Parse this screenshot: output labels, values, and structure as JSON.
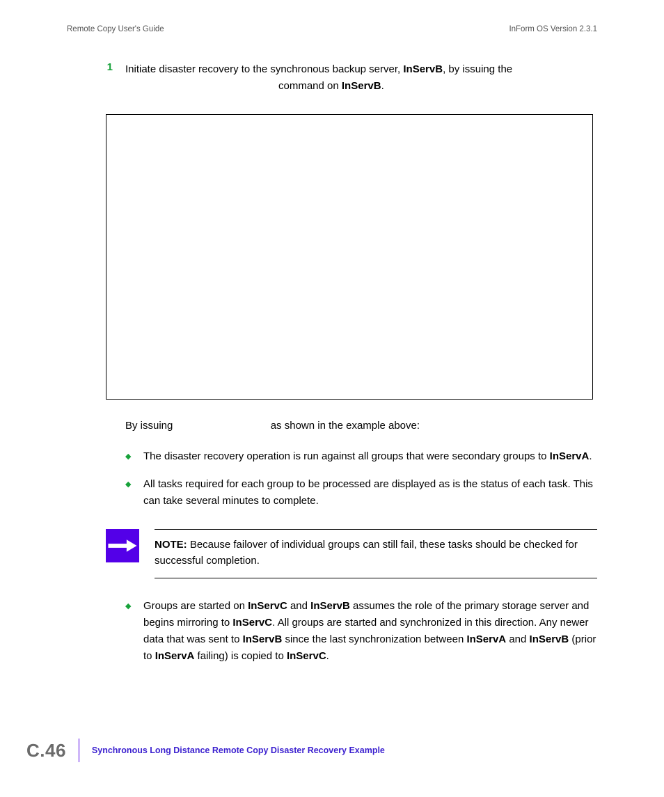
{
  "header": {
    "left": "Remote Copy User's Guide",
    "right": "InForm OS Version 2.3.1"
  },
  "step": {
    "number": "1",
    "line1_pre": "Initiate disaster recovery to the synchronous backup server, ",
    "line1_bold1": "InServB",
    "line1_post": ", by issuing the",
    "line2_pre": "command on ",
    "line2_bold": "InServB",
    "line2_post": "."
  },
  "after_code": {
    "pre": "By issuing ",
    "post": " as shown in the example above:"
  },
  "bullets": [
    {
      "parts": [
        {
          "t": "The disaster recovery operation is run against all groups that were secondary groups to "
        },
        {
          "b": "InServA"
        },
        {
          "t": "."
        }
      ]
    },
    {
      "parts": [
        {
          "t": "All tasks required for each group to be processed are displayed as is the status of each task. This can take several minutes to complete."
        }
      ]
    }
  ],
  "note": {
    "label": "NOTE:",
    "text": " Because failover of individual groups can still fail, these tasks should be checked for successful completion."
  },
  "bullet3": {
    "p1": "Groups are started on ",
    "b1": "InServC",
    "p2": " and ",
    "b2": "InServB",
    "p3": " assumes the role of the primary storage server and begins mirroring to ",
    "b3": "InServC",
    "p4": ". All groups are started and synchronized in this direction. Any newer data that was sent to ",
    "b4": "InServB",
    "p5": " since the last synchronization between ",
    "b5": "InServA",
    "p6": " and ",
    "b6": "InServB",
    "p7": " (prior to ",
    "b7": "InServA",
    "p8": " failing) is copied to ",
    "b8": "InServC",
    "p9": "."
  },
  "footer": {
    "page": "C.46",
    "title": "Synchronous Long Distance Remote Copy Disaster Recovery Example"
  }
}
